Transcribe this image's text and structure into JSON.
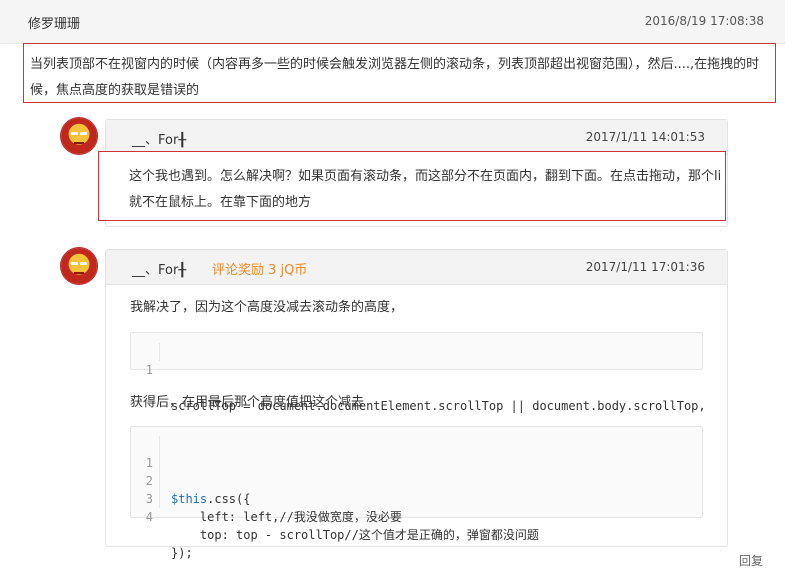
{
  "top_comment": {
    "author": "修罗珊珊",
    "time": "2016/8/19 17:08:38",
    "body": "当列表顶部不在视窗内的时候（内容再多一些的时候会触发浏览器左侧的滚动条，列表顶部超出视窗范围），然后....,在拖拽的时候，焦点高度的获取是错误的"
  },
  "replies": [
    {
      "author": "__、For╂",
      "time": "2017/1/11 14:01:53",
      "body": "这个我也遇到。怎么解决啊？如果页面有滚动条，而这部分不在页面内，翻到下面。在点击拖动，那个li就不在鼠标上。在靠下面的地方"
    },
    {
      "author": "__、For╂",
      "reward": "评论奖励 3 jQ币",
      "time": "2017/1/11 17:01:36",
      "para1": "我解决了，因为这个高度没减去滚动条的高度，",
      "code1": [
        {
          "n": "1",
          "text": "scrollTop = document.documentElement.scrollTop || document.body.scrollTop,"
        }
      ],
      "para2": "获得后，在用最后那个高度值把这个减去",
      "code2": [
        {
          "n": "1",
          "kw": "$this",
          "text": ".css({"
        },
        {
          "n": "2",
          "text": "    left: left,//我没做宽度，没必要"
        },
        {
          "n": "3",
          "text": "    top: top - scrollTop//这个值才是正确的，弹窗都没问题"
        },
        {
          "n": "4",
          "text": "});"
        }
      ]
    }
  ],
  "reply_link": "回复"
}
